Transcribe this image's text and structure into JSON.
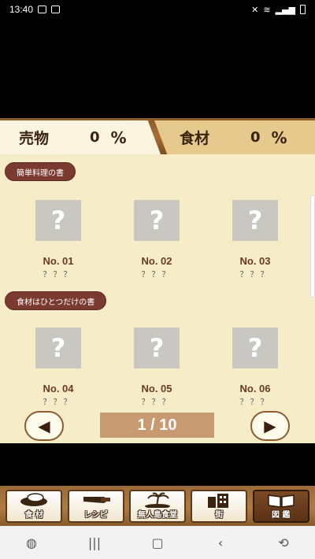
{
  "status_bar": {
    "time": "13:40"
  },
  "tabs": [
    {
      "label": "売物",
      "percent": "0",
      "percent_sign": "%"
    },
    {
      "label": "食材",
      "percent": "0",
      "percent_sign": "%"
    }
  ],
  "sections": [
    {
      "title": "簡単料理の書",
      "items": [
        {
          "placeholder": "?",
          "number": "No. 01",
          "name": "？？？"
        },
        {
          "placeholder": "?",
          "number": "No. 02",
          "name": "？？？"
        },
        {
          "placeholder": "?",
          "number": "No. 03",
          "name": "？？？"
        }
      ]
    },
    {
      "title": "食材はひとつだけの書",
      "items": [
        {
          "placeholder": "?",
          "number": "No. 04",
          "name": "？？？"
        },
        {
          "placeholder": "?",
          "number": "No. 05",
          "name": "？？？"
        },
        {
          "placeholder": "?",
          "number": "No. 06",
          "name": "？？？"
        }
      ]
    }
  ],
  "pagination": {
    "label": "1 / 10",
    "prev_icon": "◀",
    "next_icon": "▶"
  },
  "menu": [
    {
      "label": "食 材",
      "icon": "ingredients-icon",
      "active": false
    },
    {
      "label": "レシピ",
      "icon": "knife-icon",
      "active": false
    },
    {
      "label": "無人島食堂",
      "icon": "island-icon",
      "active": false
    },
    {
      "label": "街",
      "icon": "city-icon",
      "active": false
    },
    {
      "label": "図 鑑",
      "icon": "book-icon",
      "active": true
    }
  ],
  "colors": {
    "page_bg": "#f7ecc8",
    "wood": "#a86e34",
    "pill": "#7a3a30",
    "item_number": "#6a3a20",
    "page_indicator": "#c79a72"
  }
}
